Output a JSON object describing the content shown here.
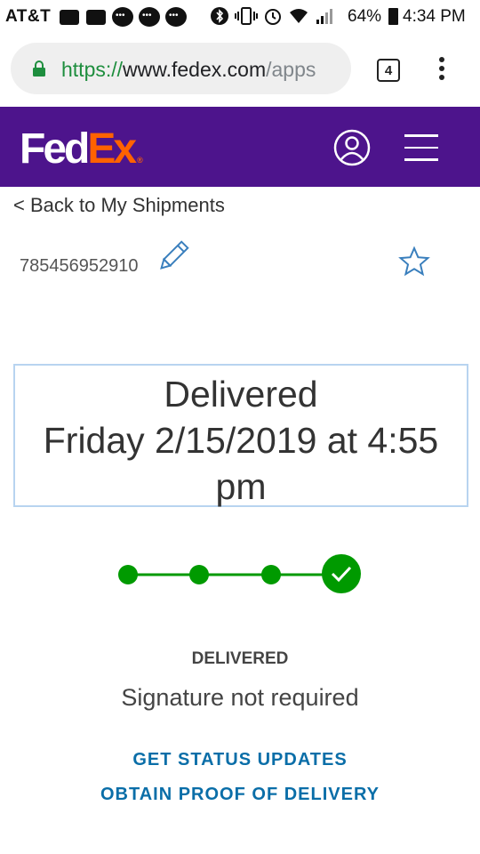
{
  "status_bar": {
    "carrier": "AT&T",
    "battery_percent": "64%",
    "time": "4:34 PM"
  },
  "browser": {
    "url_scheme": "https://",
    "url_host": "www.fedex.com",
    "url_path": "/apps",
    "tab_count": "4"
  },
  "header": {
    "logo_fed": "Fed",
    "logo_ex": "Ex",
    "logo_mark": "®",
    "brand_purple": "#4d148c",
    "brand_orange": "#ff6200"
  },
  "shipment": {
    "back_link": "< Back to My Shipments",
    "tracking_number": "785456952910",
    "status_line1": "Delivered",
    "status_line2": "Friday 2/15/2019 at 4:55",
    "status_line3": "pm",
    "progress_steps": 4,
    "progress_completed": 4,
    "progress_color": "#009a00",
    "status_label": "DELIVERED",
    "signature": "Signature not required"
  },
  "actions": {
    "get_status_updates": "GET STATUS UPDATES",
    "obtain_proof": "OBTAIN PROOF OF DELIVERY"
  },
  "icons": {
    "lock": "lock-icon",
    "profile": "profile-icon",
    "menu": "hamburger-icon",
    "edit": "pencil-icon",
    "favorite": "star-icon",
    "check": "check-icon"
  }
}
